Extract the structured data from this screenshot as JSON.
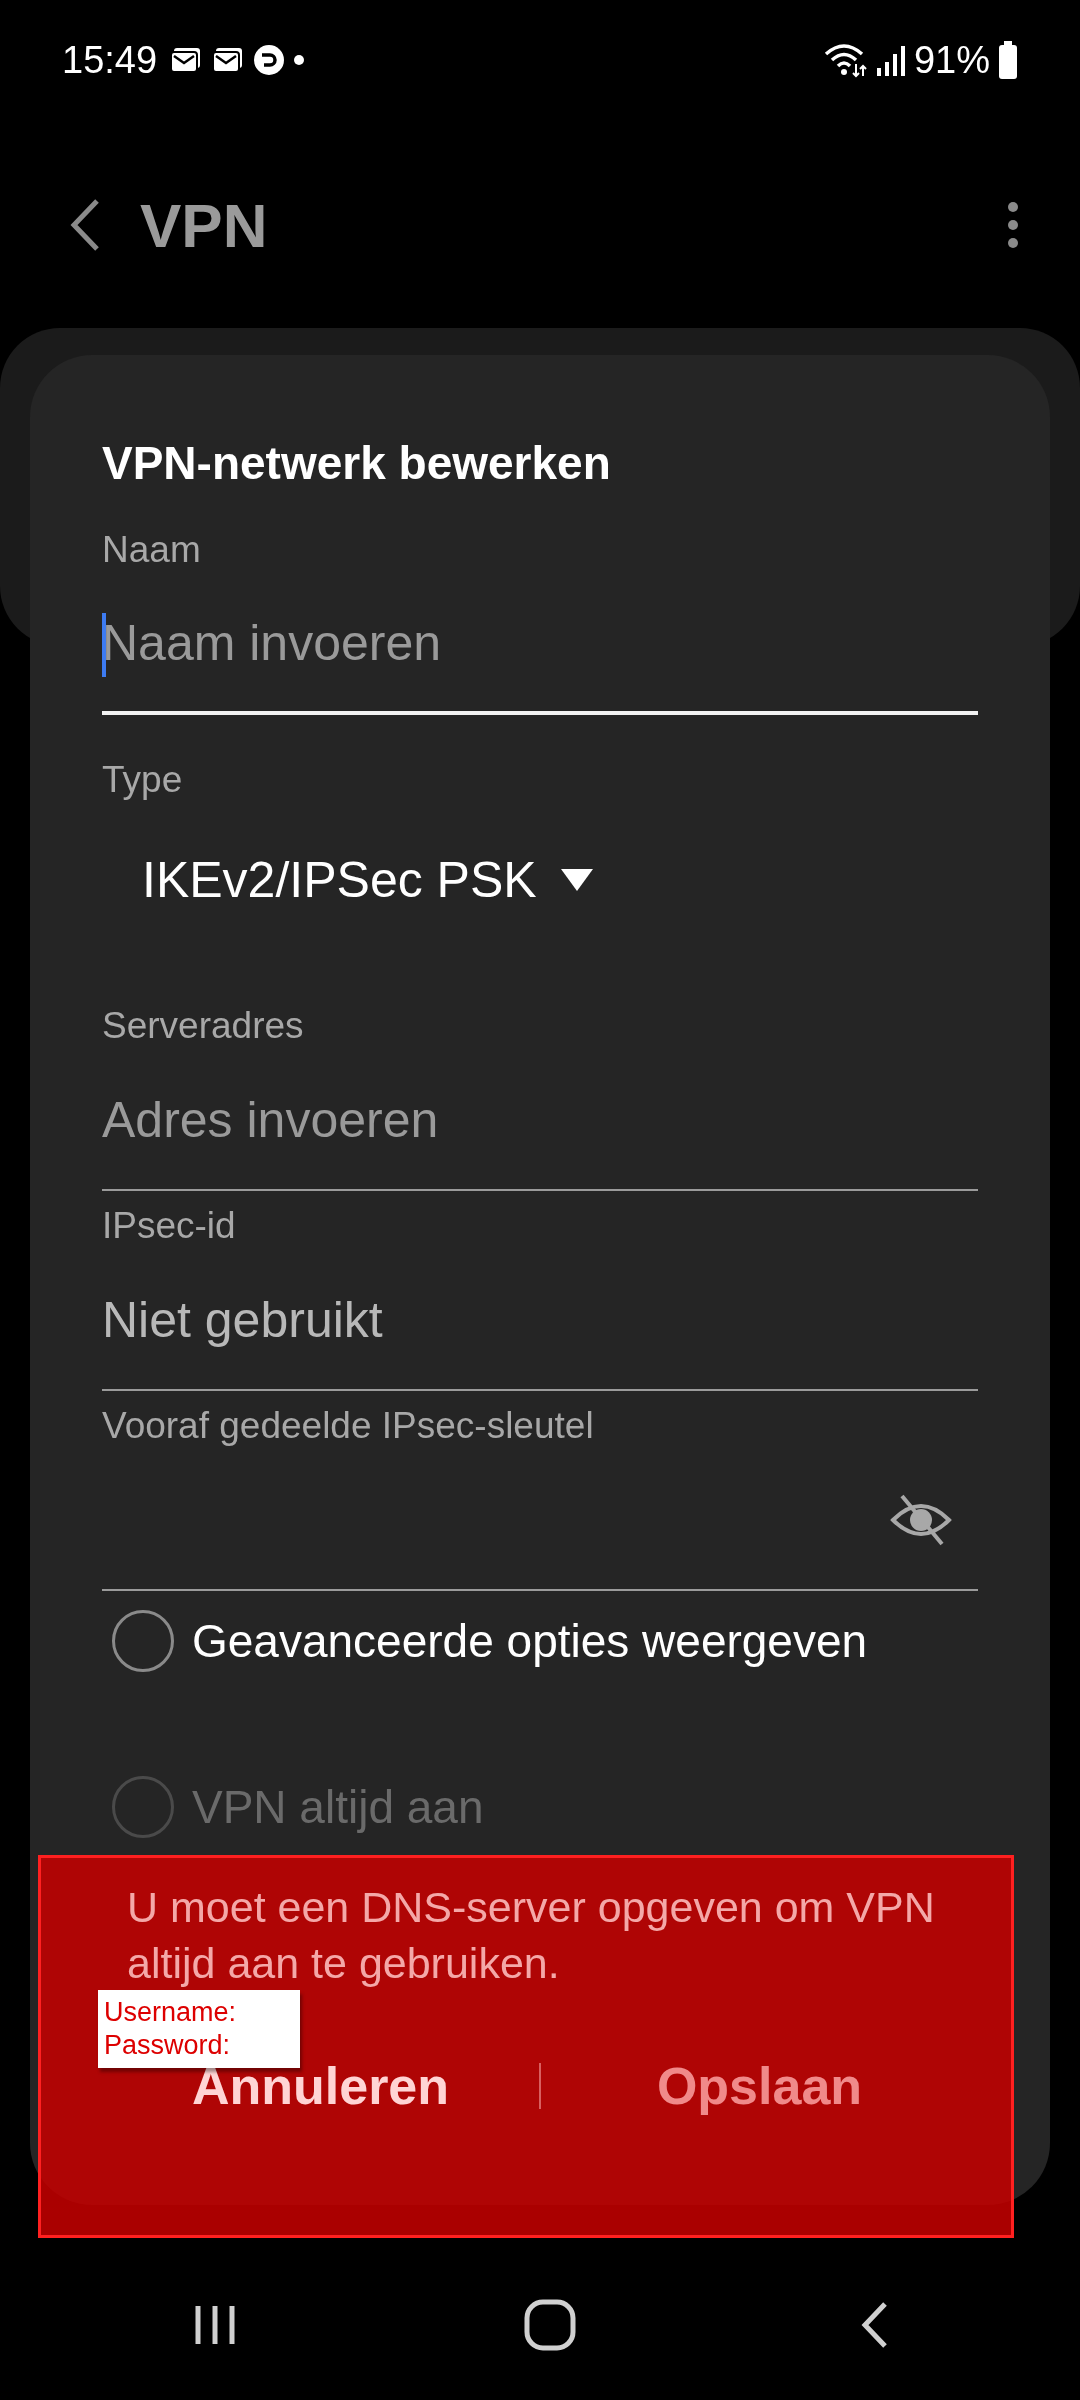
{
  "status_bar": {
    "time": "15:49",
    "battery": "91%"
  },
  "app_bar": {
    "title": "VPN"
  },
  "dialog": {
    "title": "VPN-netwerk bewerken",
    "fields": [
      {
        "kind": "text",
        "label": "Naam",
        "placeholder": "Naam invoeren",
        "focused": true
      },
      {
        "kind": "dropdown",
        "label": "Type",
        "value": "IKEv2/IPSec PSK"
      },
      {
        "kind": "text",
        "label": "Serveradres",
        "placeholder": "Adres invoeren",
        "focused": false
      },
      {
        "kind": "text",
        "label": "IPsec-id",
        "placeholder": "Niet gebruikt",
        "focused": false
      },
      {
        "kind": "password",
        "label": "Vooraf gedeelde IPsec-sleutel",
        "focused": false
      }
    ],
    "options": [
      {
        "label": "Geavanceerde opties weergeven",
        "checked": false,
        "disabled": false
      },
      {
        "label": "VPN altijd aan",
        "checked": false,
        "disabled": true
      }
    ],
    "message": "U moet een DNS-server opgeven om VPN altijd aan te gebruiken.",
    "buttons": [
      {
        "label": "Annuleren",
        "disabled": false
      },
      {
        "label": "Opslaan",
        "disabled": true
      }
    ]
  },
  "annotation": {
    "lines": [
      "Username:",
      "Password:"
    ]
  }
}
